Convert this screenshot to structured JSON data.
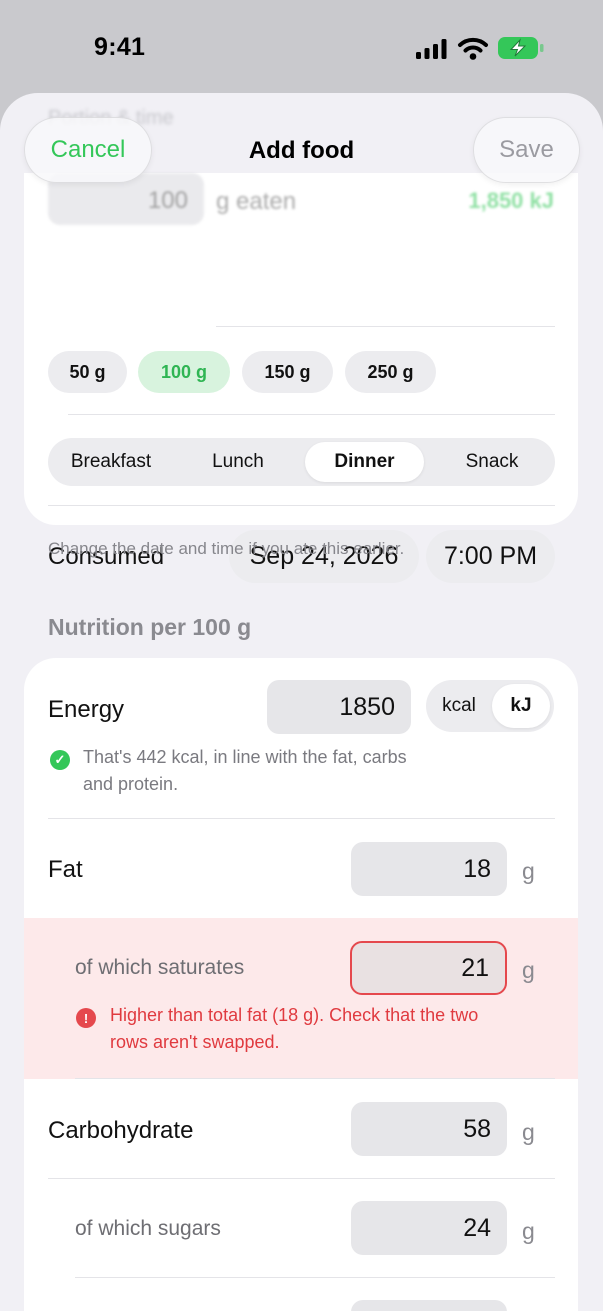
{
  "status_bar": {
    "time": "9:41"
  },
  "nav": {
    "cancel": "Cancel",
    "title": "Add food",
    "save": "Save"
  },
  "blurred": {
    "section_title": "Portion & time",
    "amount": "100",
    "amount_suffix": "g eaten",
    "energy_total": "1,850 kJ"
  },
  "portion_chips": [
    {
      "label": "50 g",
      "selected": false
    },
    {
      "label": "100 g",
      "selected": true
    },
    {
      "label": "150 g",
      "selected": false
    },
    {
      "label": "250 g",
      "selected": false
    }
  ],
  "meal": {
    "options": [
      "Breakfast",
      "Lunch",
      "Dinner",
      "Snack"
    ],
    "selected": "Dinner"
  },
  "consumed": {
    "label": "Consumed",
    "date": "Sep 24, 2026",
    "time": "7:00 PM"
  },
  "footnote": "Change the date and time if you ate this earlier.",
  "nutrition": {
    "header": "Nutrition per 100 g",
    "energy": {
      "label": "Energy",
      "value": "1850",
      "units": [
        "kcal",
        "kJ"
      ],
      "selected_unit": "kJ",
      "hint_line1": "That's 442 kcal, in line with the fat, carbs",
      "hint_line2": "and protein."
    },
    "fat": {
      "label": "Fat",
      "value": "18",
      "unit": "g"
    },
    "saturates": {
      "label": "of which saturates",
      "value": "21",
      "unit": "g",
      "error_line1": "Higher than total fat (18 g). Check that the two",
      "error_line2": "rows aren't swapped."
    },
    "carbohydrate": {
      "label": "Carbohydrate",
      "value": "58",
      "unit": "g"
    },
    "sugars": {
      "label": "of which sugars",
      "value": "24",
      "unit": "g"
    }
  },
  "colors": {
    "accent": "#34c759",
    "error": "#e5484d",
    "sheet_bg": "#f1f0f5"
  },
  "icons": [
    "cellular-signal-icon",
    "wifi-icon",
    "battery-charging-icon",
    "checkmark-circle-icon",
    "exclamation-circle-icon"
  ]
}
